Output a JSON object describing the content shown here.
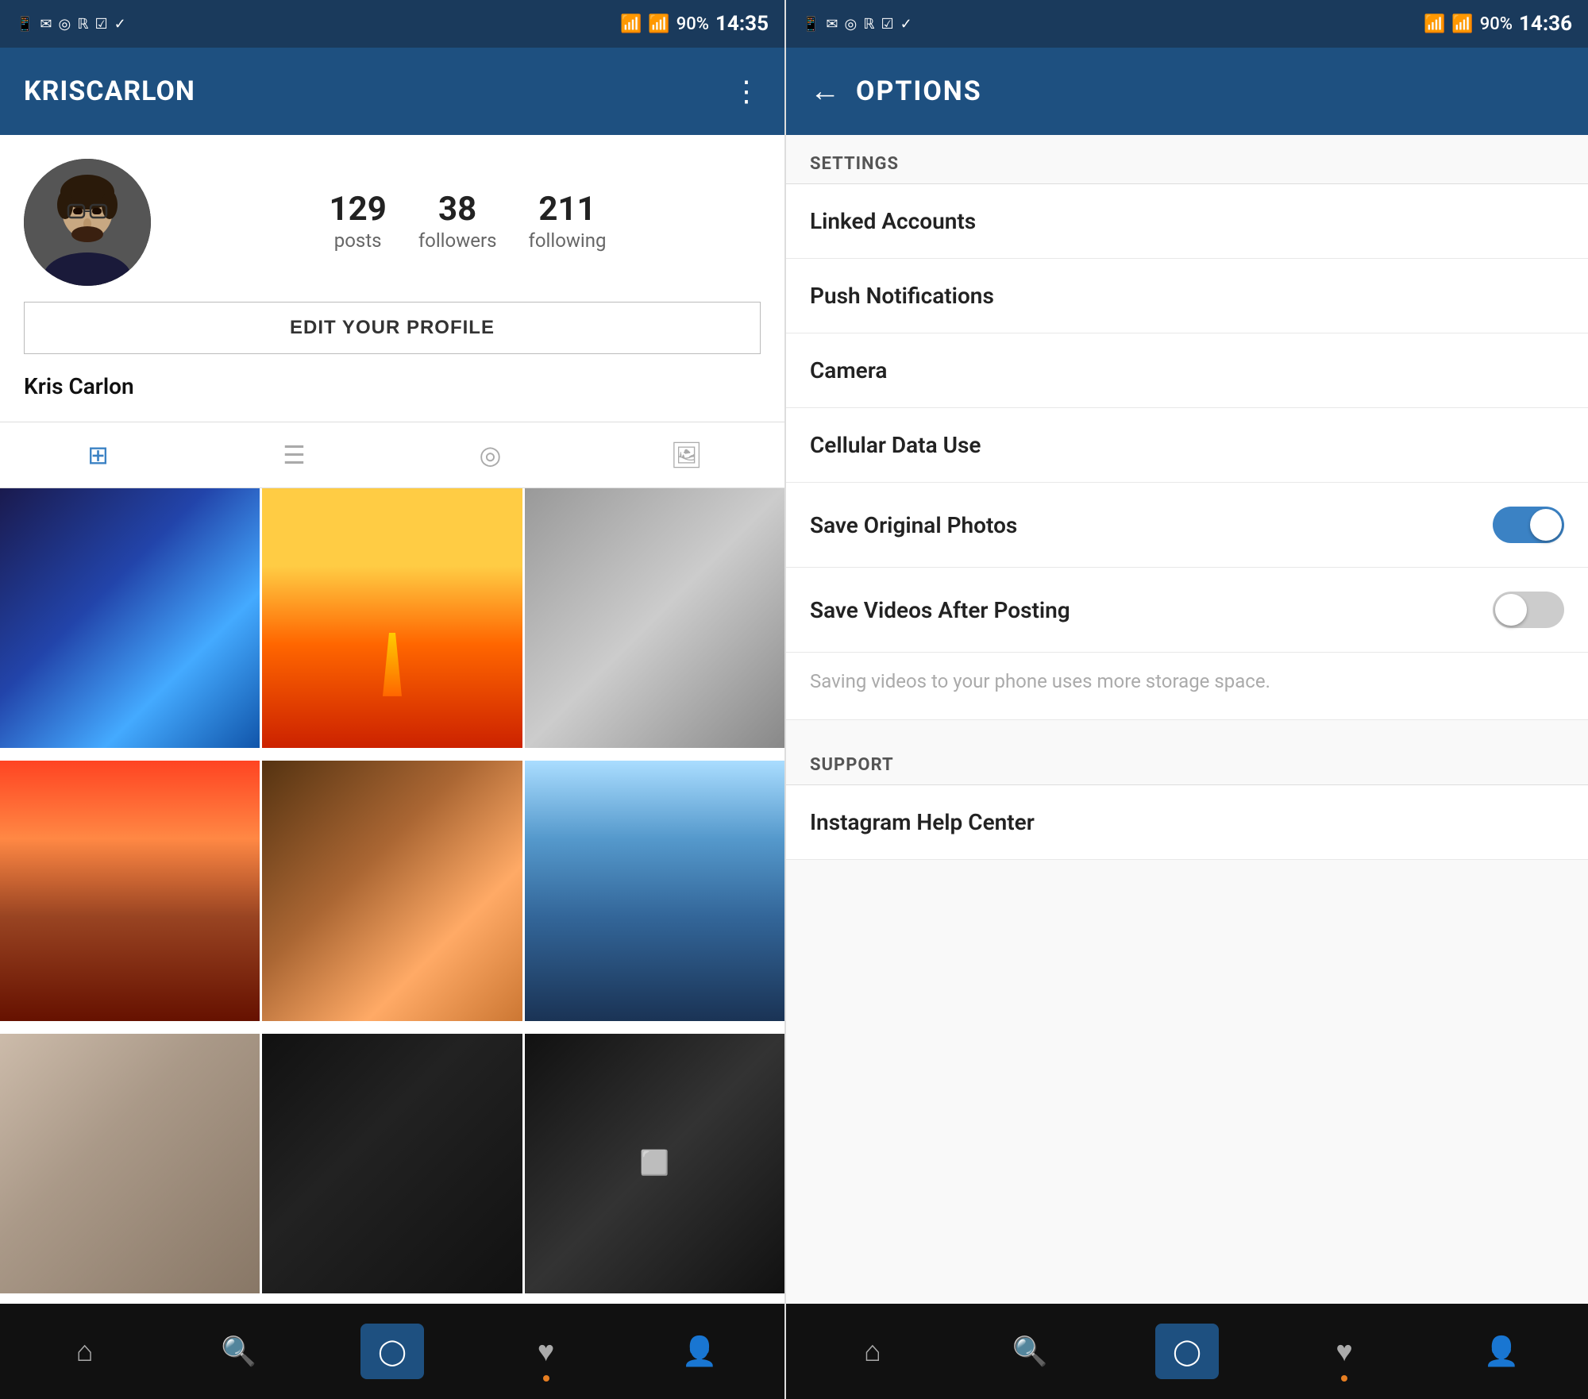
{
  "left_panel": {
    "status_bar": {
      "time": "14:35",
      "battery": "90%",
      "icons": [
        "screen-icon",
        "mail-icon",
        "shazam-icon",
        "rdio-icon",
        "task-icon",
        "check-icon"
      ]
    },
    "header": {
      "title": "KRISCARLON",
      "menu_label": "⋮"
    },
    "profile": {
      "username": "Kris Carlon",
      "stats": [
        {
          "value": "129",
          "label": "posts"
        },
        {
          "value": "38",
          "label": "followers"
        },
        {
          "value": "211",
          "label": "following"
        }
      ],
      "edit_button": "EDIT YOUR PROFILE"
    },
    "tabs": [
      {
        "icon": "⊞",
        "label": "grid-view",
        "active": true
      },
      {
        "icon": "≡",
        "label": "list-view",
        "active": false
      },
      {
        "icon": "◎",
        "label": "location-view",
        "active": false
      },
      {
        "icon": "🖼",
        "label": "tagged-view",
        "active": false
      }
    ],
    "bottom_nav": [
      {
        "icon": "⌂",
        "label": "home",
        "active": false,
        "dot": false
      },
      {
        "icon": "🔍",
        "label": "search",
        "active": false,
        "dot": false
      },
      {
        "icon": "◯",
        "label": "camera",
        "active": true,
        "dot": false
      },
      {
        "icon": "♥",
        "label": "activity",
        "active": false,
        "dot": true
      },
      {
        "icon": "👤",
        "label": "profile",
        "active": false,
        "dot": false
      }
    ]
  },
  "right_panel": {
    "status_bar": {
      "time": "14:36",
      "battery": "90%"
    },
    "header": {
      "back_label": "←",
      "title": "OPTIONS"
    },
    "settings": {
      "section_title": "SETTINGS",
      "items": [
        {
          "label": "Linked Accounts",
          "type": "link"
        },
        {
          "label": "Push Notifications",
          "type": "link"
        },
        {
          "label": "Camera",
          "type": "link"
        },
        {
          "label": "Cellular Data Use",
          "type": "link"
        },
        {
          "label": "Save Original Photos",
          "type": "toggle",
          "value": true
        },
        {
          "label": "Save Videos After Posting",
          "type": "toggle",
          "value": false
        }
      ],
      "toggle_note": "Saving videos to your phone uses more storage space."
    },
    "support": {
      "section_title": "SUPPORT",
      "items": [
        {
          "label": "Instagram Help Center",
          "type": "link"
        }
      ]
    },
    "bottom_nav": [
      {
        "icon": "⌂",
        "label": "home",
        "active": false,
        "dot": false
      },
      {
        "icon": "🔍",
        "label": "search",
        "active": false,
        "dot": false
      },
      {
        "icon": "◯",
        "label": "camera",
        "active": true,
        "dot": false
      },
      {
        "icon": "♥",
        "label": "activity",
        "active": false,
        "dot": true
      },
      {
        "icon": "👤",
        "label": "profile",
        "active": false,
        "dot": false
      }
    ]
  }
}
